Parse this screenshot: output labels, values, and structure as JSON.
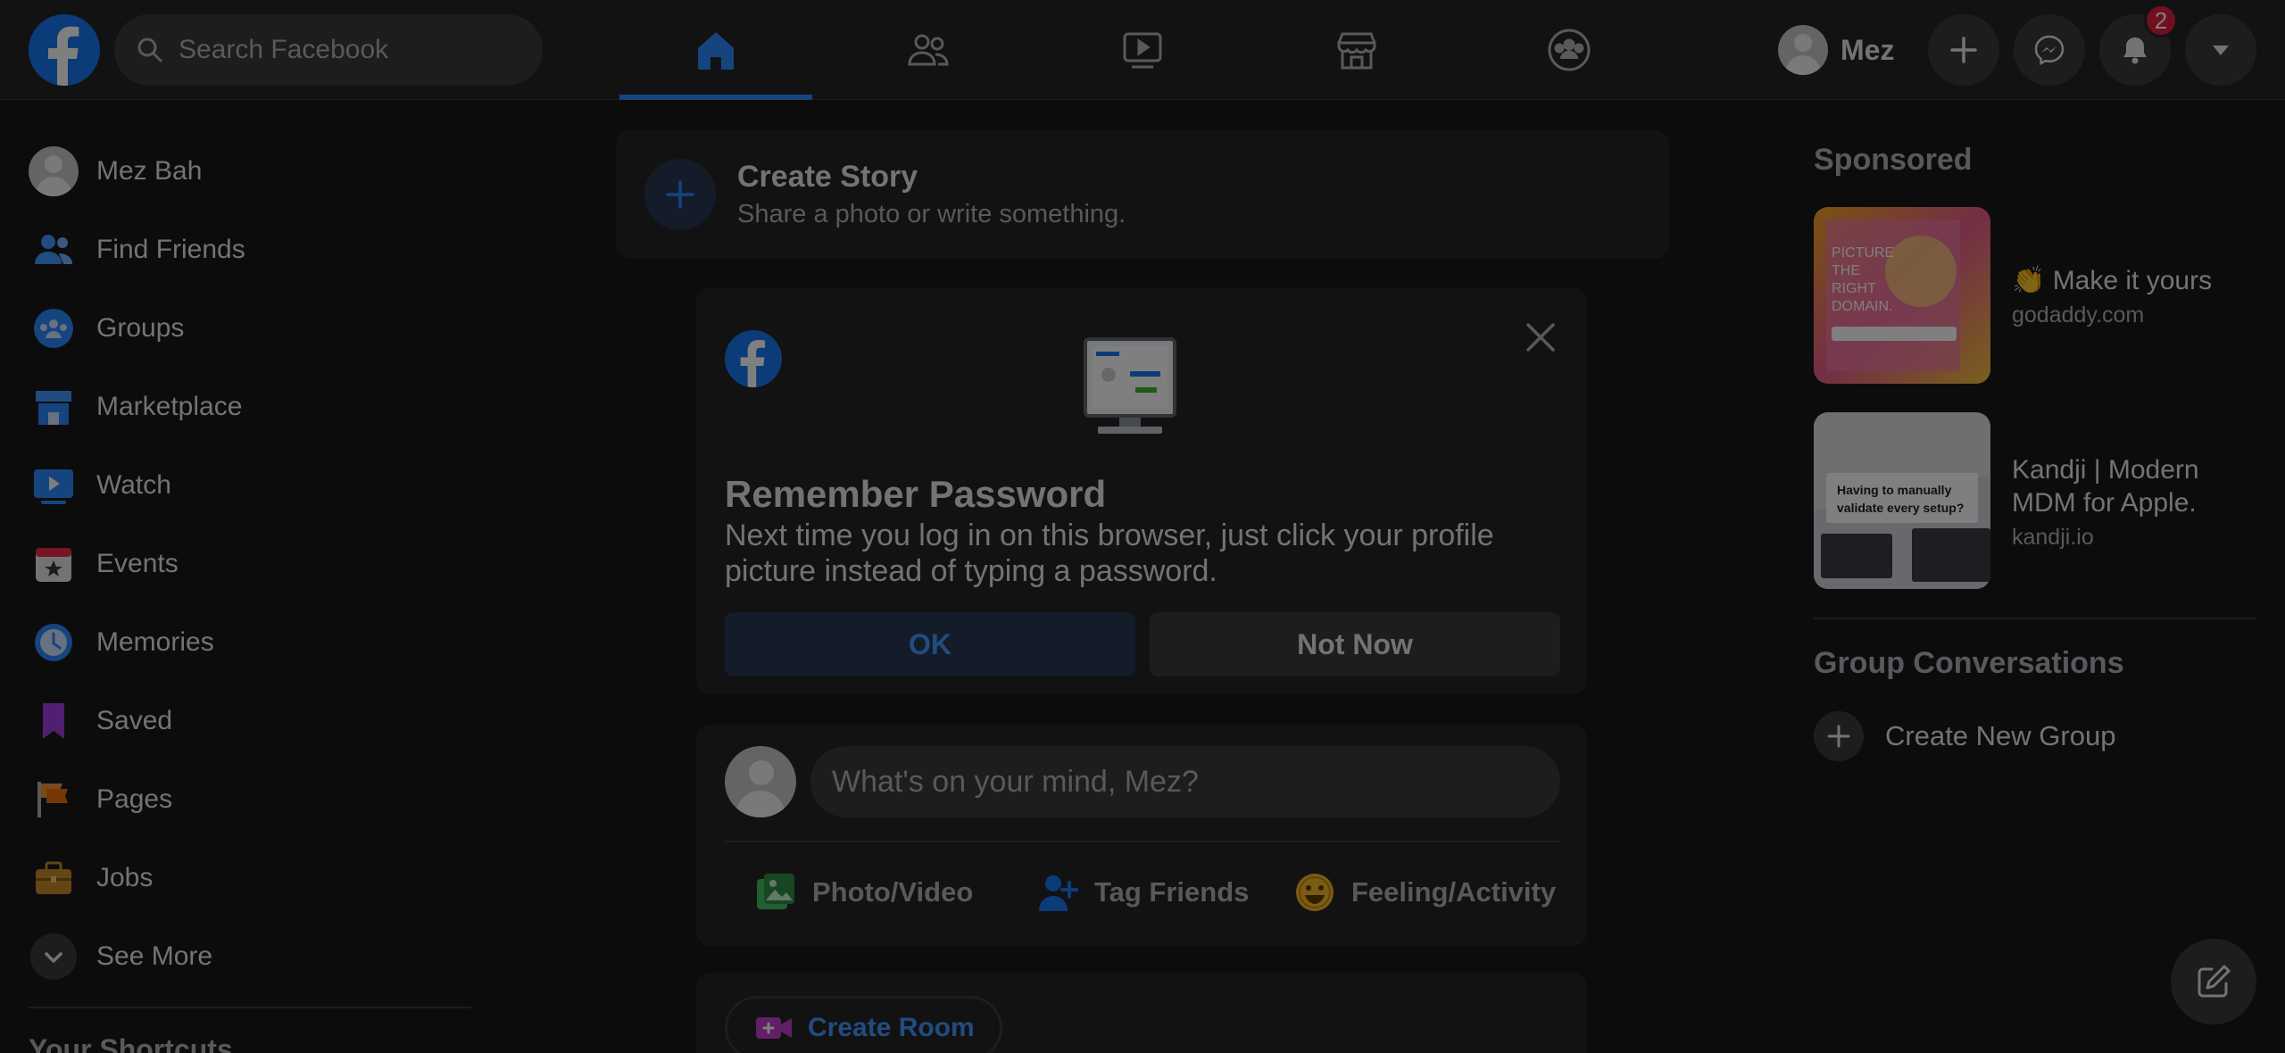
{
  "topbar": {
    "search_placeholder": "Search Facebook",
    "profile_name": "Mez",
    "notification_count": "2",
    "nav_tabs": [
      "home",
      "friends",
      "watch",
      "marketplace",
      "groups"
    ]
  },
  "left_menu": {
    "items": [
      {
        "label": "Mez Bah",
        "icon": "avatar"
      },
      {
        "label": "Find Friends",
        "icon": "friends-icon"
      },
      {
        "label": "Groups",
        "icon": "groups-icon"
      },
      {
        "label": "Marketplace",
        "icon": "marketplace-icon"
      },
      {
        "label": "Watch",
        "icon": "watch-icon"
      },
      {
        "label": "Events",
        "icon": "events-icon"
      },
      {
        "label": "Memories",
        "icon": "memories-icon"
      },
      {
        "label": "Saved",
        "icon": "saved-icon"
      },
      {
        "label": "Pages",
        "icon": "pages-icon"
      },
      {
        "label": "Jobs",
        "icon": "jobs-icon"
      },
      {
        "label": "See More",
        "icon": "chevron-down-icon"
      }
    ],
    "shortcuts_title": "Your Shortcuts"
  },
  "story": {
    "title": "Create Story",
    "subtitle": "Share a photo or write something."
  },
  "remember_password": {
    "title": "Remember Password",
    "description": "Next time you log in on this browser, just click your profile picture instead of typing a password.",
    "ok_label": "OK",
    "not_now_label": "Not Now"
  },
  "composer": {
    "placeholder": "What's on your mind, Mez?",
    "actions": [
      "Photo/Video",
      "Tag Friends",
      "Feeling/Activity"
    ]
  },
  "room": {
    "label": "Create Room"
  },
  "right_column": {
    "sponsored_title": "Sponsored",
    "ads": [
      {
        "title": "👏 Make it yours",
        "domain": "godaddy.com"
      },
      {
        "title": "Kandji | Modern MDM for Apple.",
        "domain": "kandji.io"
      }
    ],
    "ad1_image_text": "PICTURE THE RIGHT DOMAIN.",
    "ad2_image_text": "Having to manually validate every setup?",
    "group_conversations_title": "Group Conversations",
    "create_group_label": "Create New Group"
  },
  "colors": {
    "background": "#18191a",
    "surface": "#242526",
    "accent": "#2d88ff",
    "brand": "#1877f2",
    "badge": "#e41e3f"
  }
}
